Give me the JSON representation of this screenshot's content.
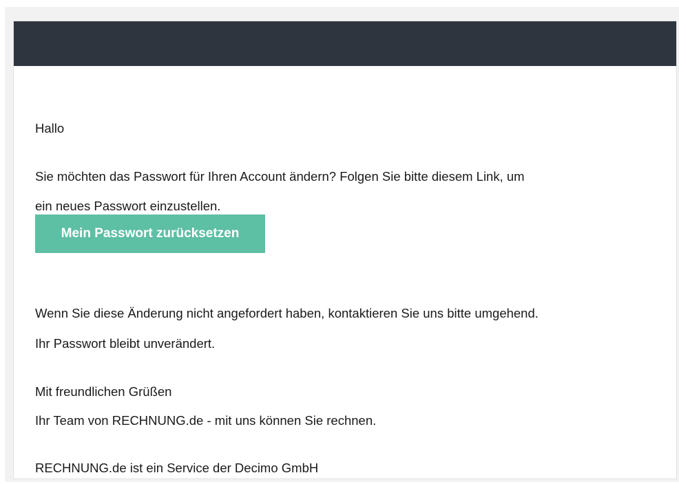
{
  "email": {
    "greeting": "Hallo",
    "intro_line1": "Sie möchten das Passwort für Ihren Account ändern? Folgen Sie bitte diesem Link, um",
    "intro_line2": "ein neues Passwort einzustellen.",
    "reset_button_label": "Mein Passwort zurücksetzen",
    "warning_line1": "Wenn Sie diese Änderung nicht angefordert haben, kontaktieren Sie uns bitte umgehend.",
    "warning_line2": "Ihr Passwort bleibt unverändert.",
    "signoff": "Mit freundlichen Grüßen",
    "team_line": "Ihr Team von RECHNUNG.de - mit uns können Sie rechnen.",
    "footer": "RECHNUNG.de ist ein Service der Decimo GmbH"
  },
  "colors": {
    "header_bar": "#2e353f",
    "button": "#5dbfa4",
    "page_background": "#f2f2f2"
  }
}
